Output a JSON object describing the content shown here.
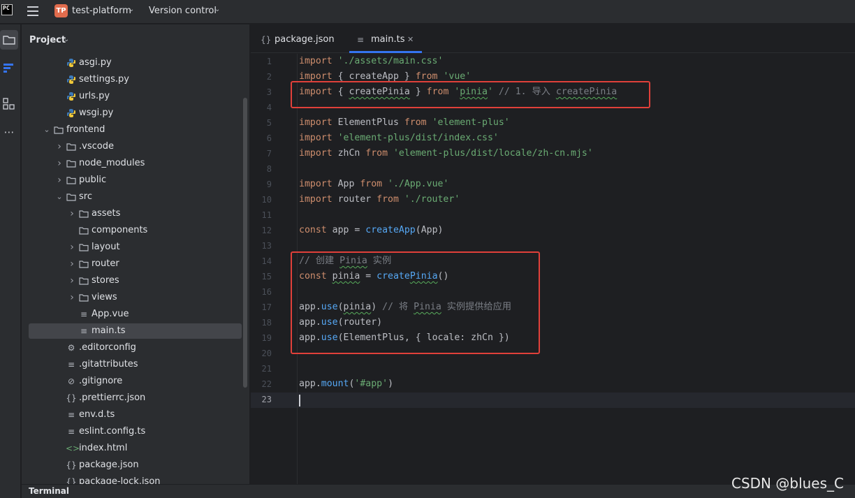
{
  "titlebar": {
    "logo_text": "PC",
    "project_badge": "TP",
    "project_name": "test-platform",
    "vcs_label": "Version control"
  },
  "project_panel": {
    "title": "Project",
    "tree": [
      {
        "label": "asgi.py",
        "icon": "python-file-icon",
        "depth": 3,
        "expand": "none"
      },
      {
        "label": "settings.py",
        "icon": "python-file-icon",
        "depth": 3,
        "expand": "none"
      },
      {
        "label": "urls.py",
        "icon": "python-file-icon",
        "depth": 3,
        "expand": "none"
      },
      {
        "label": "wsgi.py",
        "icon": "python-file-icon",
        "depth": 3,
        "expand": "none"
      },
      {
        "label": "frontend",
        "icon": "folder-icon",
        "depth": 2,
        "expand": "open"
      },
      {
        "label": ".vscode",
        "icon": "folder-icon",
        "depth": 3,
        "expand": "closed"
      },
      {
        "label": "node_modules",
        "icon": "folder-icon",
        "depth": 3,
        "expand": "closed"
      },
      {
        "label": "public",
        "icon": "folder-icon",
        "depth": 3,
        "expand": "closed"
      },
      {
        "label": "src",
        "icon": "folder-icon",
        "depth": 3,
        "expand": "open"
      },
      {
        "label": "assets",
        "icon": "folder-icon",
        "depth": 4,
        "expand": "closed"
      },
      {
        "label": "components",
        "icon": "folder-icon",
        "depth": 4,
        "expand": "none"
      },
      {
        "label": "layout",
        "icon": "folder-icon",
        "depth": 4,
        "expand": "closed"
      },
      {
        "label": "router",
        "icon": "folder-icon",
        "depth": 4,
        "expand": "closed"
      },
      {
        "label": "stores",
        "icon": "folder-icon",
        "depth": 4,
        "expand": "closed"
      },
      {
        "label": "views",
        "icon": "folder-icon",
        "depth": 4,
        "expand": "closed"
      },
      {
        "label": "App.vue",
        "icon": "text-file-icon",
        "depth": 4,
        "expand": "none"
      },
      {
        "label": "main.ts",
        "icon": "text-file-icon",
        "depth": 4,
        "expand": "none",
        "selected": true
      },
      {
        "label": ".editorconfig",
        "icon": "gear-icon",
        "depth": 3,
        "expand": "none"
      },
      {
        "label": ".gitattributes",
        "icon": "text-file-icon",
        "depth": 3,
        "expand": "none"
      },
      {
        "label": ".gitignore",
        "icon": "ignore-file-icon",
        "depth": 3,
        "expand": "none"
      },
      {
        "label": ".prettierrc.json",
        "icon": "json-file-icon",
        "depth": 3,
        "expand": "none"
      },
      {
        "label": "env.d.ts",
        "icon": "text-file-icon",
        "depth": 3,
        "expand": "none"
      },
      {
        "label": "eslint.config.ts",
        "icon": "text-file-icon",
        "depth": 3,
        "expand": "none"
      },
      {
        "label": "index.html",
        "icon": "html-file-icon",
        "depth": 3,
        "expand": "none"
      },
      {
        "label": "package.json",
        "icon": "json-file-icon",
        "depth": 3,
        "expand": "none"
      },
      {
        "label": "package-lock.json",
        "icon": "json-file-icon",
        "depth": 3,
        "expand": "none"
      }
    ]
  },
  "tabs": [
    {
      "label": "package.json",
      "icon": "json-file-icon",
      "active": false
    },
    {
      "label": "main.ts",
      "icon": "text-file-icon",
      "active": true,
      "closable": true
    }
  ],
  "bottom": {
    "terminal_label": "Terminal"
  },
  "editor": {
    "current_line": 23,
    "lines": [
      {
        "n": "1",
        "tokens": [
          [
            "kw",
            "import "
          ],
          [
            "str",
            "'./assets/main.css'"
          ]
        ]
      },
      {
        "n": "2",
        "tokens": [
          [
            "kw",
            "import "
          ],
          [
            "id",
            "{ createApp } "
          ],
          [
            "kw",
            "from "
          ],
          [
            "str",
            "'vue'"
          ]
        ]
      },
      {
        "n": "3",
        "tokens": [
          [
            "kw",
            "import "
          ],
          [
            "id",
            "{ "
          ],
          [
            "id sq",
            "createPinia"
          ],
          [
            "id",
            " } "
          ],
          [
            "kw",
            "from "
          ],
          [
            "str",
            "'"
          ],
          [
            "str sq",
            "pinia"
          ],
          [
            "str",
            "'"
          ],
          [
            "cm",
            " // 1. 导入 "
          ],
          [
            "cm sq",
            "createPinia"
          ]
        ]
      },
      {
        "n": "4",
        "tokens": []
      },
      {
        "n": "5",
        "tokens": [
          [
            "kw",
            "import "
          ],
          [
            "id",
            "ElementPlus "
          ],
          [
            "kw",
            "from "
          ],
          [
            "str",
            "'element-plus'"
          ]
        ]
      },
      {
        "n": "6",
        "tokens": [
          [
            "kw",
            "import "
          ],
          [
            "str",
            "'element-plus/dist/index.css'"
          ]
        ]
      },
      {
        "n": "7",
        "tokens": [
          [
            "kw",
            "import "
          ],
          [
            "id",
            "zhCn "
          ],
          [
            "kw",
            "from "
          ],
          [
            "str",
            "'element-plus/dist/locale/zh-cn.mjs'"
          ]
        ]
      },
      {
        "n": "8",
        "tokens": []
      },
      {
        "n": "9",
        "tokens": [
          [
            "kw",
            "import "
          ],
          [
            "id",
            "App "
          ],
          [
            "kw",
            "from "
          ],
          [
            "str",
            "'./App.vue'"
          ]
        ]
      },
      {
        "n": "10",
        "tokens": [
          [
            "kw",
            "import "
          ],
          [
            "id",
            "router "
          ],
          [
            "kw",
            "from "
          ],
          [
            "str",
            "'./router'"
          ]
        ]
      },
      {
        "n": "11",
        "tokens": []
      },
      {
        "n": "12",
        "tokens": [
          [
            "kw",
            "const "
          ],
          [
            "id",
            "app = "
          ],
          [
            "fn",
            "createApp"
          ],
          [
            "id",
            "(App)"
          ]
        ]
      },
      {
        "n": "13",
        "tokens": []
      },
      {
        "n": "14",
        "tokens": [
          [
            "cm",
            "// 创建 "
          ],
          [
            "cm sq",
            "Pinia"
          ],
          [
            "cm",
            " 实例"
          ]
        ]
      },
      {
        "n": "15",
        "tokens": [
          [
            "kw",
            "const "
          ],
          [
            "id sq",
            "pinia"
          ],
          [
            "id",
            " = "
          ],
          [
            "fn",
            "create"
          ],
          [
            "fn sq",
            "Pinia"
          ],
          [
            "id",
            "()"
          ]
        ]
      },
      {
        "n": "16",
        "tokens": []
      },
      {
        "n": "17",
        "tokens": [
          [
            "id",
            "app."
          ],
          [
            "fn",
            "use"
          ],
          [
            "id",
            "("
          ],
          [
            "id sq",
            "pinia"
          ],
          [
            "id",
            ") "
          ],
          [
            "cm",
            "// 将 "
          ],
          [
            "cm sq",
            "Pinia"
          ],
          [
            "cm",
            " 实例提供给应用"
          ]
        ]
      },
      {
        "n": "18",
        "tokens": [
          [
            "id",
            "app."
          ],
          [
            "fn",
            "use"
          ],
          [
            "id",
            "(router)"
          ]
        ]
      },
      {
        "n": "19",
        "tokens": [
          [
            "id",
            "app."
          ],
          [
            "fn",
            "use"
          ],
          [
            "id",
            "(ElementPlus, { locale: zhCn })"
          ]
        ]
      },
      {
        "n": "20",
        "tokens": []
      },
      {
        "n": "21",
        "tokens": []
      },
      {
        "n": "22",
        "tokens": [
          [
            "id",
            "app."
          ],
          [
            "fn",
            "mount"
          ],
          [
            "id",
            "("
          ],
          [
            "str",
            "'#app'"
          ],
          [
            "id",
            ")"
          ]
        ]
      },
      {
        "n": "23",
        "tokens": []
      }
    ]
  },
  "watermark": "CSDN @blues_C"
}
